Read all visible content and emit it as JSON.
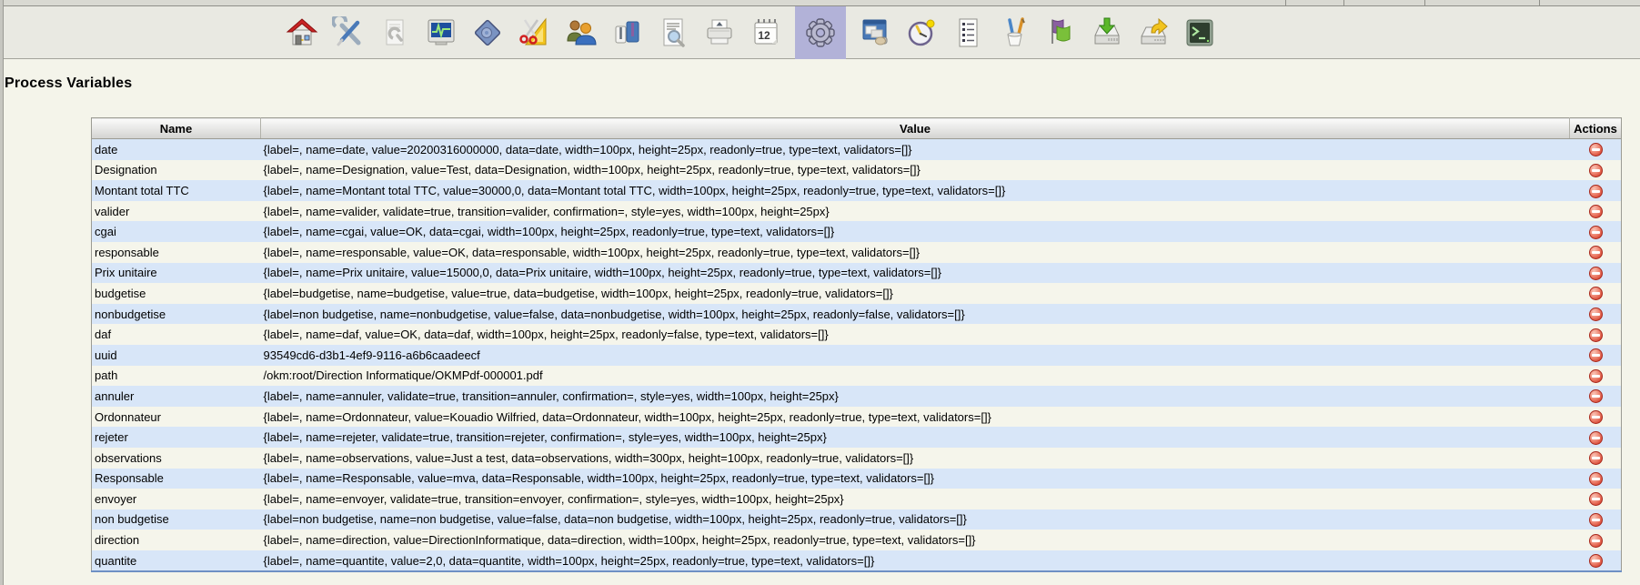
{
  "page": {
    "title": "Process Variables"
  },
  "toolbar": {
    "selected_icon": "gear-workflow",
    "calendar_label": "12",
    "icons": [
      "home",
      "tools",
      "document-wrench",
      "monitor-stats",
      "diamond-gear",
      "scissors-ruler",
      "users",
      "profiles-clothes",
      "document-search",
      "printer",
      "calendar",
      "gear-workflow",
      "window-install",
      "clock",
      "checklist",
      "pens",
      "flags",
      "drive-import",
      "drive-export",
      "terminal"
    ]
  },
  "table": {
    "columns": [
      "Name",
      "Value",
      "Actions"
    ],
    "rows": [
      {
        "name": "date",
        "value": "{label=, name=date, value=20200316000000, data=date, width=100px, height=25px, readonly=true, type=text, validators=[]}"
      },
      {
        "name": "Designation",
        "value": "{label=, name=Designation, value=Test, data=Designation, width=100px, height=25px, readonly=true, type=text, validators=[]}"
      },
      {
        "name": "Montant total TTC",
        "value": "{label=, name=Montant total TTC, value=30000,0, data=Montant total TTC, width=100px, height=25px, readonly=true, type=text, validators=[]}"
      },
      {
        "name": "valider",
        "value": "{label=, name=valider, validate=true, transition=valider, confirmation=, style=yes, width=100px, height=25px}"
      },
      {
        "name": "cgai",
        "value": "{label=, name=cgai, value=OK, data=cgai, width=100px, height=25px, readonly=true, type=text, validators=[]}"
      },
      {
        "name": "responsable",
        "value": "{label=, name=responsable, value=OK, data=responsable, width=100px, height=25px, readonly=true, type=text, validators=[]}"
      },
      {
        "name": "Prix unitaire",
        "value": "{label=, name=Prix unitaire, value=15000,0, data=Prix unitaire, width=100px, height=25px, readonly=true, type=text, validators=[]}"
      },
      {
        "name": "budgetise",
        "value": "{label=budgetise, name=budgetise, value=true, data=budgetise, width=100px, height=25px, readonly=true, validators=[]}"
      },
      {
        "name": "nonbudgetise",
        "value": "{label=non budgetise, name=nonbudgetise, value=false, data=nonbudgetise, width=100px, height=25px, readonly=false, validators=[]}"
      },
      {
        "name": "daf",
        "value": "{label=, name=daf, value=OK, data=daf, width=100px, height=25px, readonly=false, type=text, validators=[]}"
      },
      {
        "name": "uuid",
        "value": "93549cd6-d3b1-4ef9-9116-a6b6caadeecf"
      },
      {
        "name": "path",
        "value": "/okm:root/Direction Informatique/OKMPdf-000001.pdf"
      },
      {
        "name": "annuler",
        "value": "{label=, name=annuler, validate=true, transition=annuler, confirmation=, style=yes, width=100px, height=25px}"
      },
      {
        "name": "Ordonnateur",
        "value": "{label=, name=Ordonnateur, value=Kouadio Wilfried, data=Ordonnateur, width=100px, height=25px, readonly=true, type=text, validators=[]}"
      },
      {
        "name": "rejeter",
        "value": "{label=, name=rejeter, validate=true, transition=rejeter, confirmation=, style=yes, width=100px, height=25px}"
      },
      {
        "name": "observations",
        "value": "{label=, name=observations, value=Just a test, data=observations, width=300px, height=100px, readonly=true, validators=[]}"
      },
      {
        "name": "Responsable",
        "value": "{label=, name=Responsable, value=mva, data=Responsable, width=100px, height=25px, readonly=true, type=text, validators=[]}"
      },
      {
        "name": "envoyer",
        "value": "{label=, name=envoyer, validate=true, transition=envoyer, confirmation=, style=yes, width=100px, height=25px}"
      },
      {
        "name": "non budgetise",
        "value": "{label=non budgetise, name=non budgetise, value=false, data=non budgetise, width=100px, height=25px, readonly=true, validators=[]}"
      },
      {
        "name": "direction",
        "value": "{label=, name=direction, value=DirectionInformatique, data=direction, width=100px, height=25px, readonly=true, type=text, validators=[]}"
      },
      {
        "name": "quantite",
        "value": "{label=, name=quantite, value=2,0, data=quantite, width=100px, height=25px, readonly=true, type=text, validators=[]}"
      }
    ]
  },
  "colors": {
    "page_background": "#f4f4ea",
    "toolbar_background": "#e9e9e2",
    "selected_tool_background": "#b2b2d8",
    "row_alt_blue": "#d8e6f8",
    "row_alt_cream": "#f5f5eb",
    "table_bottom_border": "#6e90c4",
    "delete_icon_red": "#d9402e"
  }
}
